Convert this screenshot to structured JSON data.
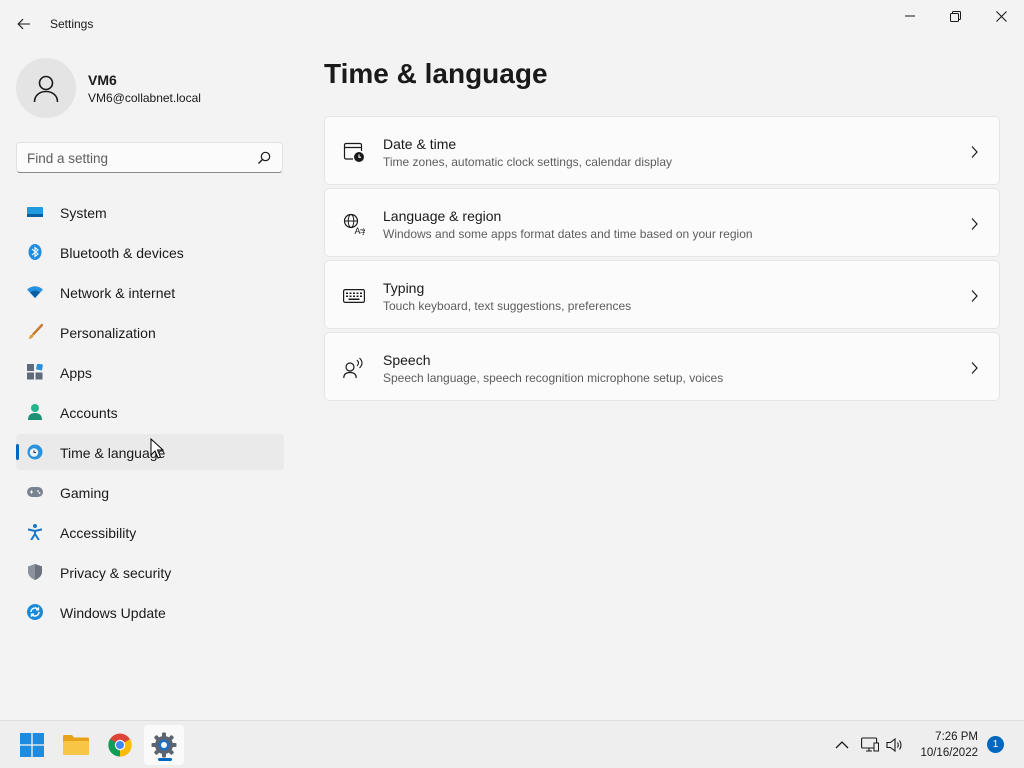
{
  "window": {
    "title": "Settings"
  },
  "profile": {
    "name": "VM6",
    "email": "VM6@collabnet.local"
  },
  "search": {
    "placeholder": "Find a setting",
    "value": ""
  },
  "sidebar": {
    "items": [
      {
        "label": "System",
        "icon": "system-icon"
      },
      {
        "label": "Bluetooth & devices",
        "icon": "bluetooth-icon"
      },
      {
        "label": "Network & internet",
        "icon": "wifi-icon"
      },
      {
        "label": "Personalization",
        "icon": "brush-icon"
      },
      {
        "label": "Apps",
        "icon": "apps-icon"
      },
      {
        "label": "Accounts",
        "icon": "accounts-icon"
      },
      {
        "label": "Time & language",
        "icon": "globe-clock-icon",
        "selected": true
      },
      {
        "label": "Gaming",
        "icon": "gamepad-icon"
      },
      {
        "label": "Accessibility",
        "icon": "accessibility-icon"
      },
      {
        "label": "Privacy & security",
        "icon": "shield-icon"
      },
      {
        "label": "Windows Update",
        "icon": "update-icon"
      }
    ]
  },
  "main": {
    "title": "Time & language",
    "cards": [
      {
        "title": "Date & time",
        "description": "Time zones, automatic clock settings, calendar display",
        "icon": "calendar-clock-icon"
      },
      {
        "title": "Language & region",
        "description": "Windows and some apps format dates and time based on your region",
        "icon": "language-icon"
      },
      {
        "title": "Typing",
        "description": "Touch keyboard, text suggestions, preferences",
        "icon": "keyboard-icon"
      },
      {
        "title": "Speech",
        "description": "Speech language, speech recognition microphone setup, voices",
        "icon": "speech-icon"
      }
    ]
  },
  "taskbar": {
    "apps": [
      "start-icon",
      "file-explorer-icon",
      "chrome-icon",
      "settings-icon"
    ],
    "clock": {
      "time": "7:26 PM",
      "date": "10/16/2022"
    },
    "notifications": "1"
  },
  "colors": {
    "accent": "#0067c0",
    "background": "#f3f3f3",
    "card": "#fbfbfb"
  }
}
